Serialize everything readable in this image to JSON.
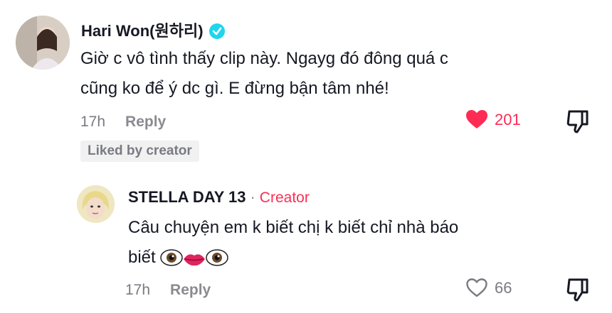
{
  "comment": {
    "author": "Hari Won(원하리)",
    "line1": "Giờ c vô tình thấy clip này. Ngayg đó đông quá c",
    "line2": "cũng ko để ý dc gì. E đừng bận tâm nhé!",
    "time": "17h",
    "reply_label": "Reply",
    "likes": "201",
    "liked_by": "Liked by creator"
  },
  "reply": {
    "author": "STELLA DAY 13",
    "separator": "·",
    "creator_label": "Creator",
    "line1": "Câu chuyện em k biết chị k biết chỉ nhà báo",
    "line2": "biết",
    "time": "17h",
    "reply_label": "Reply",
    "likes": "66"
  },
  "colors": {
    "accent": "#fe2c55",
    "verified": "#20d5ec",
    "muted": "#7a7b82"
  },
  "icons": [
    "verified-badge-icon",
    "heart-filled-icon",
    "heart-outline-icon",
    "thumbs-down-icon",
    "eyes-emoji",
    "lips-emoji"
  ]
}
